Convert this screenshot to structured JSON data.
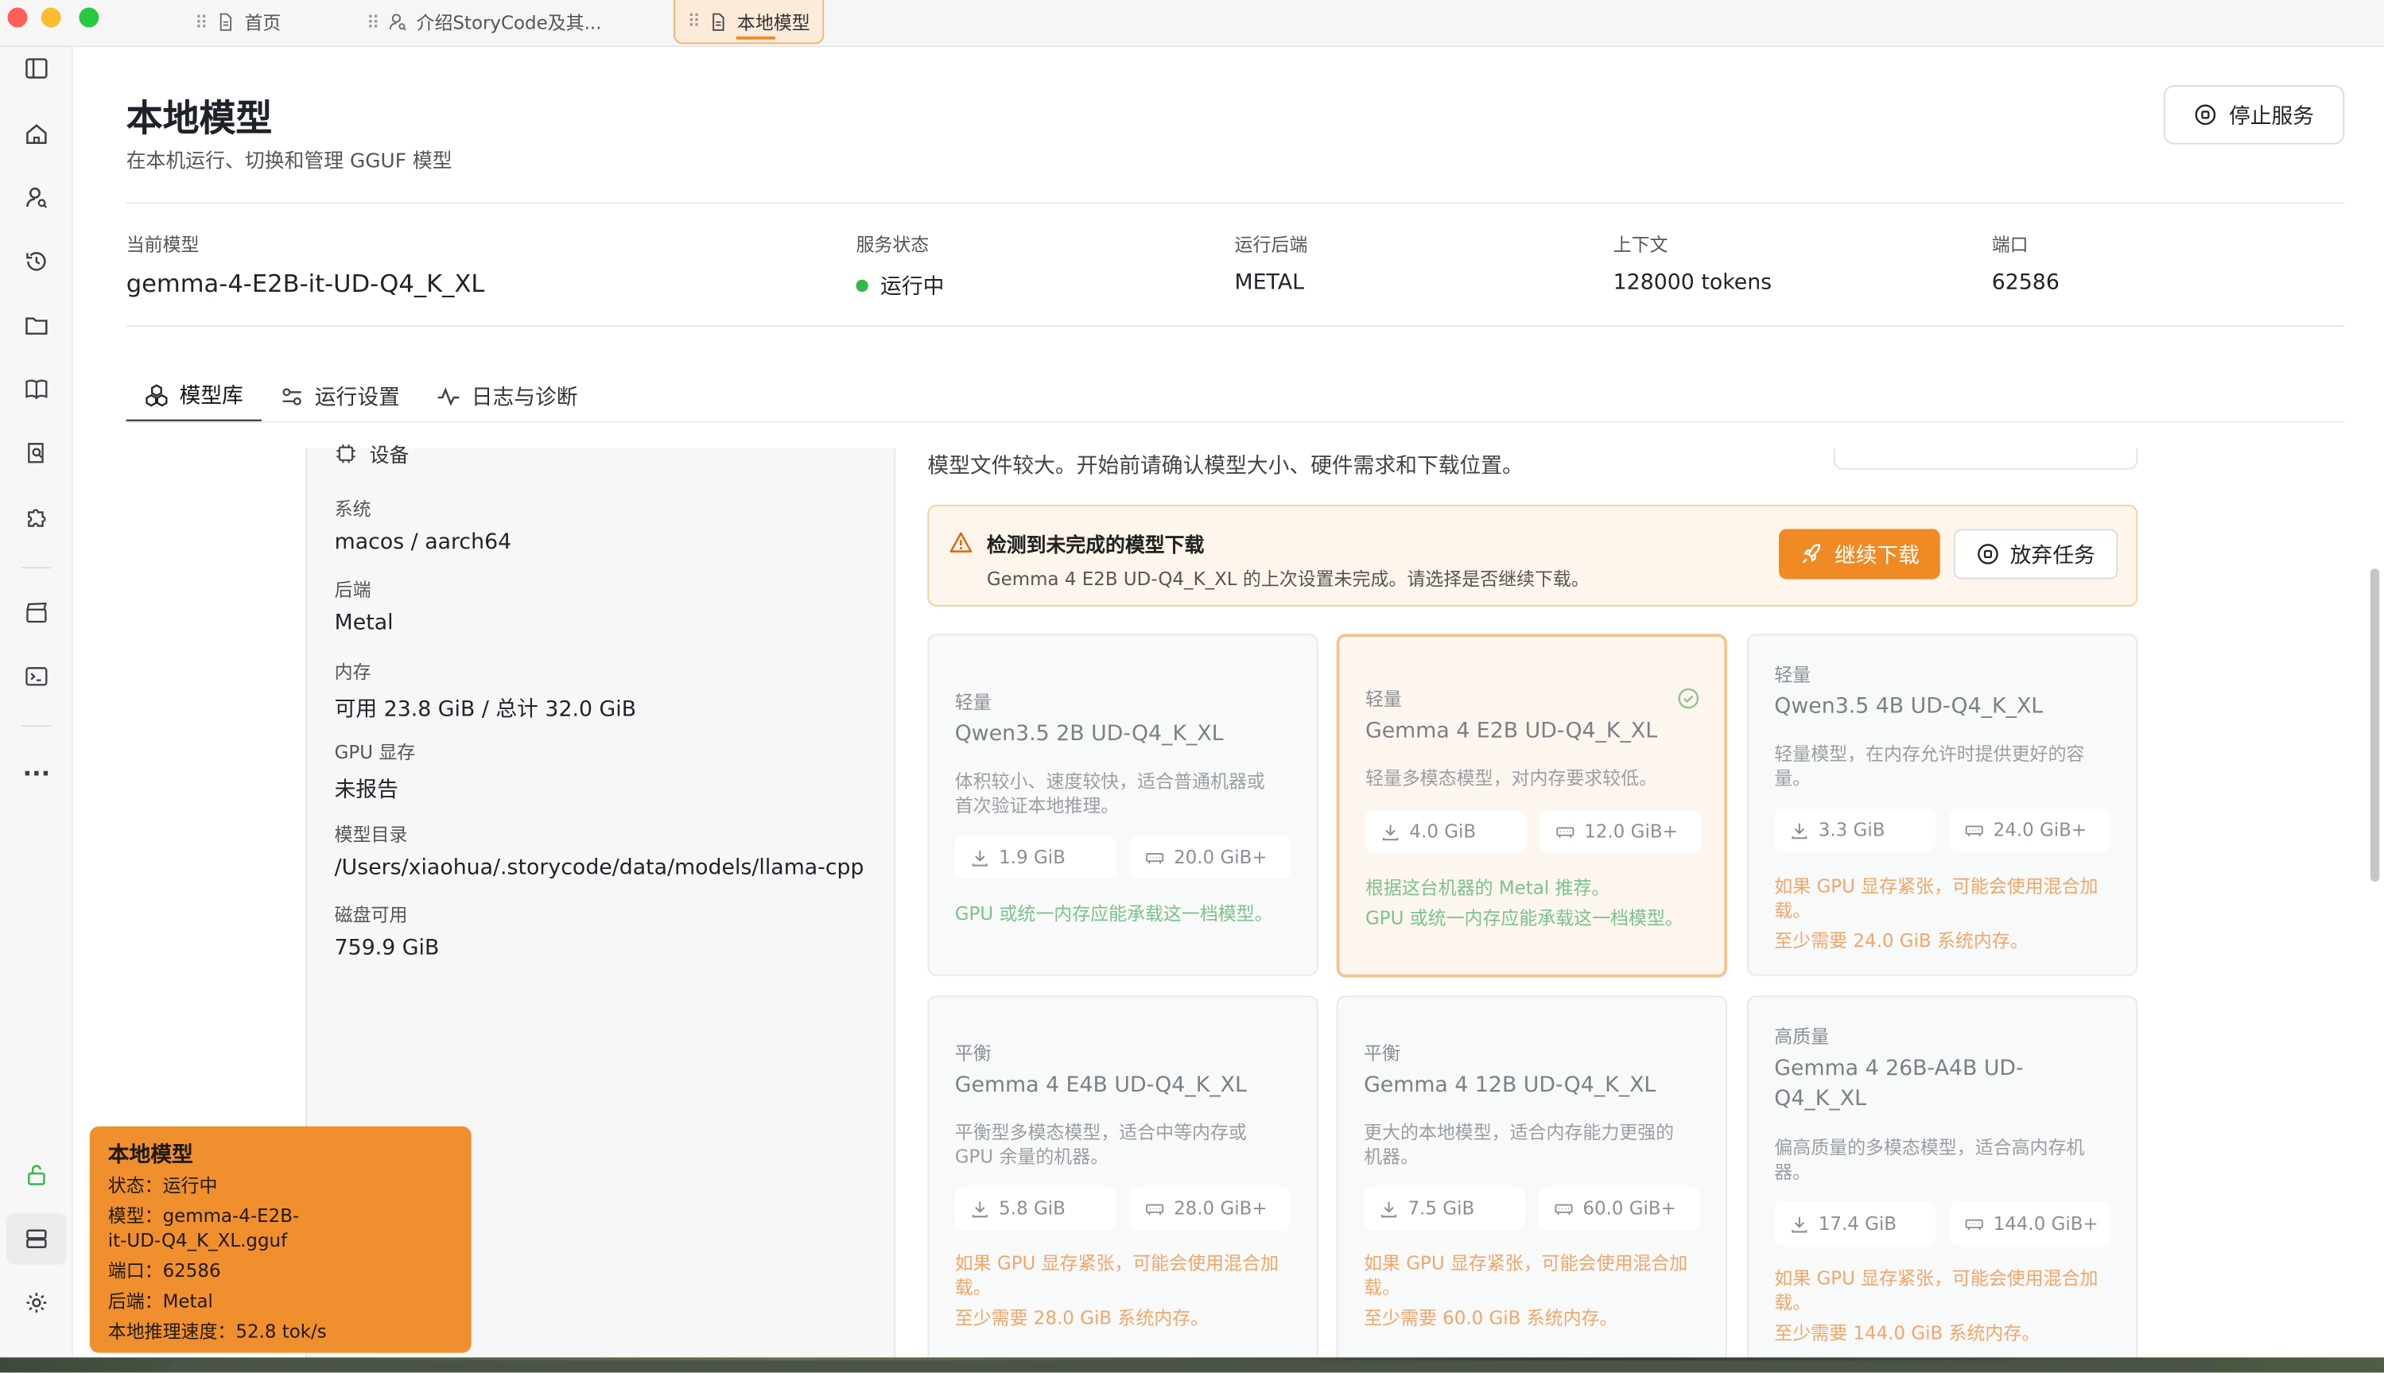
{
  "window": {
    "tabs": [
      {
        "label": "首页",
        "icon": "document-icon"
      },
      {
        "label": "介绍StoryCode及其...",
        "icon": "user-search-icon"
      },
      {
        "label": "本地模型",
        "icon": "document-icon"
      }
    ]
  },
  "page": {
    "title": "本地模型",
    "subtitle": "在本机运行、切换和管理 GGUF 模型",
    "stop_button": "停止服务"
  },
  "status": {
    "current_model_label": "当前模型",
    "current_model": "gemma-4-E2B-it-UD-Q4_K_XL",
    "service_label": "服务状态",
    "service_value": "运行中",
    "backend_label": "运行后端",
    "backend_value": "METAL",
    "context_label": "上下文",
    "context_value": "128000 tokens",
    "port_label": "端口",
    "port_value": "62586"
  },
  "page_tabs": [
    {
      "label": "模型库",
      "icon": "models-icon"
    },
    {
      "label": "运行设置",
      "icon": "sliders-icon"
    },
    {
      "label": "日志与诊断",
      "icon": "activity-icon"
    }
  ],
  "device": {
    "heading": "设备",
    "rows": [
      {
        "key": "系统",
        "value": "macos / aarch64"
      },
      {
        "key": "后端",
        "value": "Metal"
      },
      {
        "key": "内存",
        "value": "可用 23.8 GiB / 总计 32.0 GiB"
      },
      {
        "key": "GPU 显存",
        "value": "未报告"
      },
      {
        "key": "模型目录",
        "value": "/Users/xiaohua/.storycode/data/models/llama-cpp"
      },
      {
        "key": "磁盘可用",
        "value": "759.9 GiB"
      }
    ]
  },
  "library": {
    "intro": "模型文件较大。开始前请确认模型大小、硬件需求和下载位置。",
    "alert": {
      "title": "检测到未完成的模型下载",
      "description": "Gemma 4 E2B UD-Q4_K_XL 的上次设置未完成。请选择是否继续下载。",
      "resume_button": "继续下载",
      "abandon_button": "放弃任务"
    },
    "cards": [
      {
        "tier": "轻量",
        "name": "Qwen3.5 2B UD-Q4_K_XL",
        "desc": [
          "体积较小、速度较快，适合普通机器或",
          "首次验证本地推理。"
        ],
        "download": "1.9 GiB",
        "memory": "20.0 GiB+",
        "notes": [
          "GPU 或统一内存应能承载这一档模型。"
        ],
        "note_kind": "ok"
      },
      {
        "tier": "轻量",
        "name": "Gemma 4 E2B UD-Q4_K_XL",
        "desc": [
          "轻量多模态模型，对内存要求较低。"
        ],
        "download": "4.0 GiB",
        "memory": "12.0 GiB+",
        "notes": [
          "根据这台机器的 Metal 推荐。",
          "GPU 或统一内存应能承载这一档模型。"
        ],
        "note_kind": "ok"
      },
      {
        "tier": "轻量",
        "name": "Qwen3.5 4B UD-Q4_K_XL",
        "desc": [
          "轻量模型，在内存允许时提供更好的容",
          "量。"
        ],
        "download": "3.3 GiB",
        "memory": "24.0 GiB+",
        "notes": [
          "如果 GPU 显存紧张，可能会使用混合加",
          "载。",
          "至少需要 24.0 GiB 系统内存。"
        ],
        "note_kind": "warn"
      },
      {
        "tier": "平衡",
        "name": "Gemma 4 E4B UD-Q4_K_XL",
        "desc": [
          "平衡型多模态模型，适合中等内存或",
          "GPU 余量的机器。"
        ],
        "download": "5.8 GiB",
        "memory": "28.0 GiB+",
        "notes": [
          "如果 GPU 显存紧张，可能会使用混合加",
          "载。",
          "至少需要 28.0 GiB 系统内存。"
        ],
        "note_kind": "warn"
      },
      {
        "tier": "平衡",
        "name": "Gemma 4 12B UD-Q4_K_XL",
        "desc": [
          "更大的本地模型，适合内存能力更强的",
          "机器。"
        ],
        "download": "7.5 GiB",
        "memory": "60.0 GiB+",
        "notes": [
          "如果 GPU 显存紧张，可能会使用混合加",
          "载。",
          "至少需要 60.0 GiB 系统内存。"
        ],
        "note_kind": "warn"
      },
      {
        "tier": "高质量",
        "name": "Gemma 4 26B-A4B UD-\nQ4_K_XL",
        "desc": [
          "偏高质量的多模态模型，适合高内存机",
          "器。"
        ],
        "download": "17.4 GiB",
        "memory": "144.0 GiB+",
        "notes": [
          "如果 GPU 显存紧张，可能会使用混合加",
          "载。",
          "至少需要 144.0 GiB 系统内存。"
        ],
        "note_kind": "warn"
      }
    ]
  },
  "toast": {
    "title": "本地模型",
    "lines": [
      "状态：运行中",
      "模型：gemma-4-E2B-",
      "it-UD-Q4_K_XL.gguf",
      "端口：62586",
      "后端：Metal",
      "本地推理速度：52.8 tok/s"
    ]
  },
  "colors": {
    "accent": "#f08a24",
    "ok": "#34b84a",
    "toast": "#f08f2e"
  }
}
